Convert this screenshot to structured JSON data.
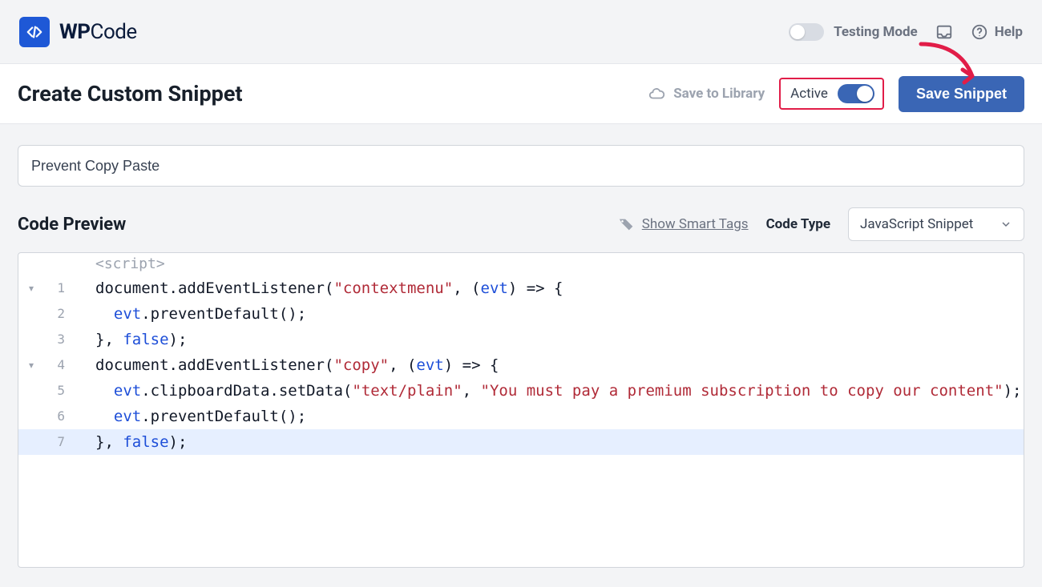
{
  "brand": {
    "name_bold": "WP",
    "name_rest": "Code"
  },
  "topbar": {
    "testing_mode_label": "Testing Mode",
    "help_label": "Help"
  },
  "actionbar": {
    "page_title": "Create Custom Snippet",
    "save_to_library_label": "Save to Library",
    "active_label": "Active",
    "active_on": true,
    "save_button_label": "Save Snippet"
  },
  "form": {
    "snippet_title_value": "Prevent Copy Paste"
  },
  "preview": {
    "title": "Code Preview",
    "smart_tags_label": "Show Smart Tags",
    "code_type_label": "Code Type",
    "code_type_value": "JavaScript Snippet"
  },
  "editor": {
    "script_open_tag": "<script>",
    "lines": [
      {
        "n": 1,
        "fold": "▾",
        "tokens": [
          {
            "t": "document",
            "c": "tok-key"
          },
          {
            "t": ".",
            "c": "tok-punc"
          },
          {
            "t": "addEventListener",
            "c": "tok-func"
          },
          {
            "t": "(",
            "c": "tok-punc"
          },
          {
            "t": "\"contextmenu\"",
            "c": "tok-str"
          },
          {
            "t": ", (",
            "c": "tok-punc"
          },
          {
            "t": "evt",
            "c": "tok-arg"
          },
          {
            "t": ") => {",
            "c": "tok-punc"
          }
        ]
      },
      {
        "n": 2,
        "tokens": [
          {
            "t": "  ",
            "c": "tok-punc"
          },
          {
            "t": "evt",
            "c": "tok-arg"
          },
          {
            "t": ".",
            "c": "tok-punc"
          },
          {
            "t": "preventDefault",
            "c": "tok-func"
          },
          {
            "t": "();",
            "c": "tok-punc"
          }
        ]
      },
      {
        "n": 3,
        "tokens": [
          {
            "t": "}, ",
            "c": "tok-punc"
          },
          {
            "t": "false",
            "c": "tok-bool"
          },
          {
            "t": ");",
            "c": "tok-punc"
          }
        ]
      },
      {
        "n": 4,
        "fold": "▾",
        "tokens": [
          {
            "t": "document",
            "c": "tok-key"
          },
          {
            "t": ".",
            "c": "tok-punc"
          },
          {
            "t": "addEventListener",
            "c": "tok-func"
          },
          {
            "t": "(",
            "c": "tok-punc"
          },
          {
            "t": "\"copy\"",
            "c": "tok-str"
          },
          {
            "t": ", (",
            "c": "tok-punc"
          },
          {
            "t": "evt",
            "c": "tok-arg"
          },
          {
            "t": ") => {",
            "c": "tok-punc"
          }
        ]
      },
      {
        "n": 5,
        "tokens": [
          {
            "t": "  ",
            "c": "tok-punc"
          },
          {
            "t": "evt",
            "c": "tok-arg"
          },
          {
            "t": ".",
            "c": "tok-punc"
          },
          {
            "t": "clipboardData",
            "c": "tok-key"
          },
          {
            "t": ".",
            "c": "tok-punc"
          },
          {
            "t": "setData",
            "c": "tok-func"
          },
          {
            "t": "(",
            "c": "tok-punc"
          },
          {
            "t": "\"text/plain\"",
            "c": "tok-str"
          },
          {
            "t": ", ",
            "c": "tok-punc"
          },
          {
            "t": "\"You must pay a premium subscription to copy our content\"",
            "c": "tok-str"
          },
          {
            "t": ");",
            "c": "tok-punc"
          }
        ]
      },
      {
        "n": 6,
        "tokens": [
          {
            "t": "  ",
            "c": "tok-punc"
          },
          {
            "t": "evt",
            "c": "tok-arg"
          },
          {
            "t": ".",
            "c": "tok-punc"
          },
          {
            "t": "preventDefault",
            "c": "tok-func"
          },
          {
            "t": "();",
            "c": "tok-punc"
          }
        ]
      },
      {
        "n": 7,
        "current": true,
        "tokens": [
          {
            "t": "}, ",
            "c": "tok-punc"
          },
          {
            "t": "false",
            "c": "tok-bool"
          },
          {
            "t": ");",
            "c": "tok-punc"
          }
        ]
      }
    ]
  }
}
